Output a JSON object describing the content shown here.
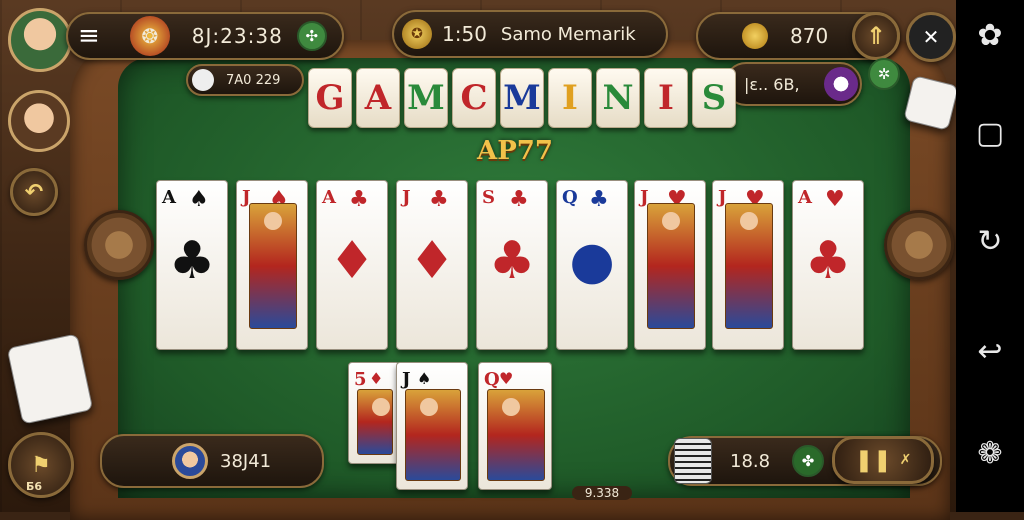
{
  "hud": {
    "timer": "8J:23:38",
    "center_count": "1:50",
    "player_name": "Samo Memarik",
    "coins": "870",
    "opponent_score": "7A0 229",
    "mini_score": "|ε..  6B,"
  },
  "title": {
    "tiles": [
      "G",
      "A",
      "M",
      "C",
      "M",
      "I",
      "N",
      "I",
      "S"
    ],
    "tile_colors": [
      "#c0262a",
      "#c0262a",
      "#2a8a3a",
      "#c0262a",
      "#1a3a9a",
      "#e0a020",
      "#2a8a3a",
      "#c0262a",
      "#2a8a3a"
    ],
    "subtitle": "AP77"
  },
  "table_cards": [
    {
      "index": "A",
      "suit": "♠",
      "color": "blk",
      "kind": "pip",
      "center": "♣"
    },
    {
      "index": "J",
      "suit": "♠",
      "color": "red",
      "kind": "face"
    },
    {
      "index": "A",
      "suit": "♣",
      "color": "red",
      "kind": "pip",
      "center": "♦"
    },
    {
      "index": "J",
      "suit": "♣",
      "color": "red",
      "kind": "pip",
      "center": "♦"
    },
    {
      "index": "S",
      "suit": "♣",
      "color": "red",
      "kind": "pip",
      "center": "♣"
    },
    {
      "index": "Q",
      "suit": "♣",
      "color": "blu",
      "kind": "pip",
      "center": "●"
    },
    {
      "index": "J",
      "suit": "♥",
      "color": "red",
      "kind": "face"
    },
    {
      "index": "J",
      "suit": "♥",
      "color": "red",
      "kind": "face"
    },
    {
      "index": "A",
      "suit": "♥",
      "color": "red",
      "kind": "pip",
      "center": "♣"
    }
  ],
  "hand_cards": [
    {
      "index": "5",
      "suit": "♦",
      "color": "red"
    },
    {
      "index": "J",
      "suit": "♠",
      "color": "blk"
    },
    {
      "index": "Q",
      "suit": "♥",
      "color": "red"
    }
  ],
  "bottom": {
    "player_score": "38J41",
    "pot": "9.338",
    "chips_value": "18.8",
    "left_label": "Б6"
  },
  "colors": {
    "felt": "#2a6a34",
    "gold": "#f2c24a"
  },
  "icons": {
    "menu": "hamburger-menu-icon",
    "trophy": "trophy-icon",
    "coin": "coin-icon",
    "upgrade": "arrow-up-icon",
    "close": "close-x-icon",
    "pause": "pause-icon"
  }
}
